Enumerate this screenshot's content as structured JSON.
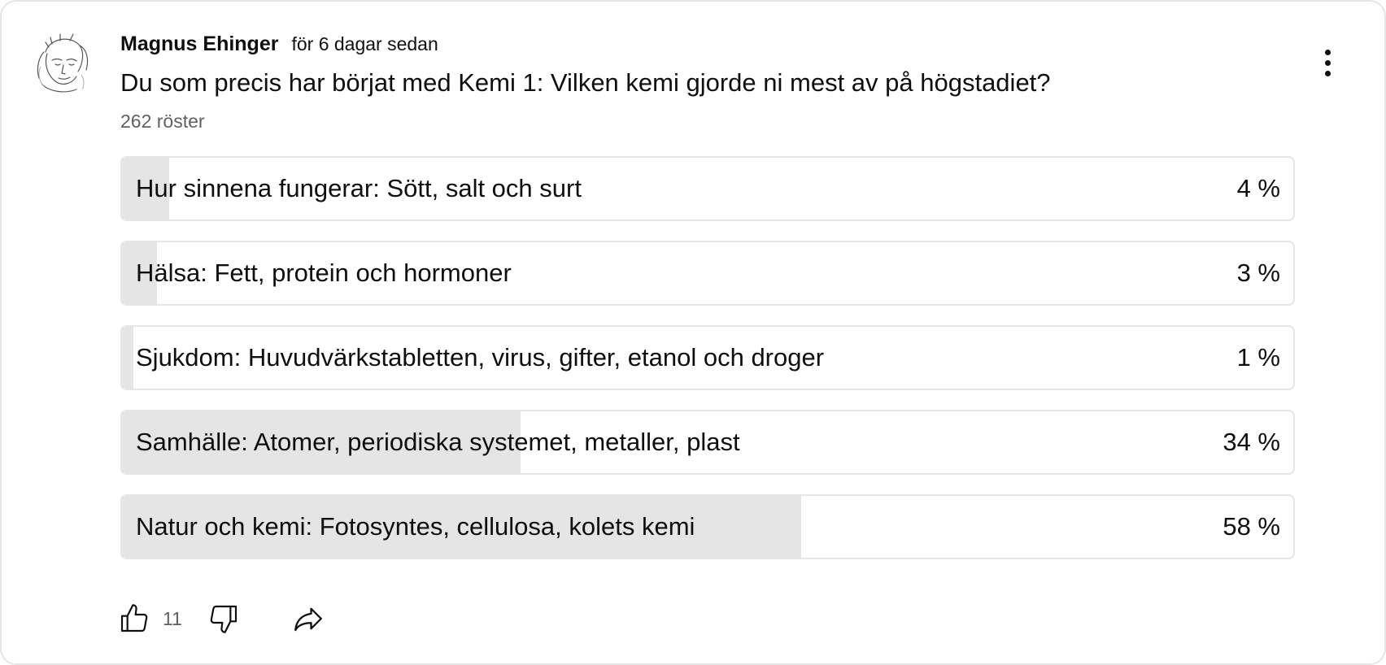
{
  "post": {
    "author": "Magnus Ehinger",
    "time": "för 6 dagar sedan",
    "question": "Du som precis har börjat med Kemi 1: Vilken kemi gjorde ni mest av på högstadiet?",
    "votes": "262 röster"
  },
  "poll": {
    "options": [
      {
        "label": "Hur sinnena fungerar: Sött, salt och surt",
        "percent_text": "4 %",
        "percent": 4
      },
      {
        "label": "Hälsa: Fett, protein och hormoner",
        "percent_text": "3 %",
        "percent": 3
      },
      {
        "label": "Sjukdom: Huvudvärkstabletten, virus, gifter, etanol och droger",
        "percent_text": "1 %",
        "percent": 1
      },
      {
        "label": "Samhälle: Atomer, periodiska systemet, metaller, plast",
        "percent_text": "34 %",
        "percent": 34
      },
      {
        "label": "Natur och kemi: Fotosyntes, cellulosa, kolets kemi",
        "percent_text": "58 %",
        "percent": 58
      }
    ]
  },
  "actions": {
    "like_count": "11",
    "like_icon": "thumbs-up-icon",
    "dislike_icon": "thumbs-down-icon",
    "share_icon": "share-icon",
    "menu_icon": "more-vertical-icon"
  },
  "colors": {
    "fill": "#e5e5e5",
    "border": "#e5e5e5",
    "text": "#0f0f0f",
    "secondary_text": "#606060"
  }
}
